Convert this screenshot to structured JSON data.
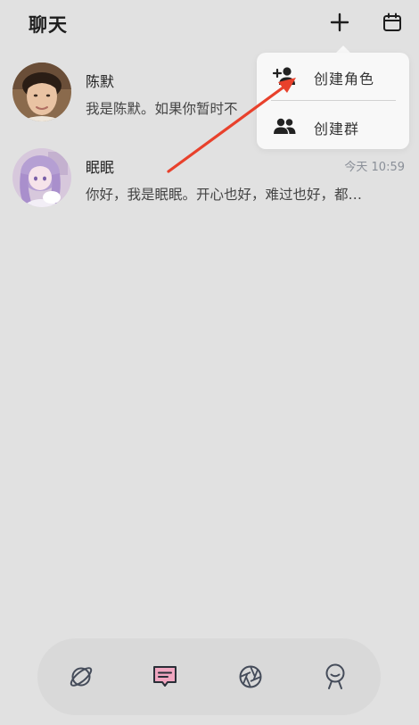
{
  "header": {
    "title": "聊天"
  },
  "chats": [
    {
      "name": "陈默",
      "preview": "我是陈默。如果你暂时不",
      "time": ""
    },
    {
      "name": "眠眠",
      "preview": "你好，我是眠眠。开心也好，难过也好，都…",
      "time": "今天 10:59"
    }
  ],
  "menu": {
    "items": [
      {
        "label": "创建角色",
        "icon": "add-person-icon"
      },
      {
        "label": "创建群",
        "icon": "group-icon"
      }
    ]
  },
  "nav": {
    "items": [
      {
        "icon": "planet-icon",
        "active": false
      },
      {
        "icon": "chat-icon",
        "active": true
      },
      {
        "icon": "aperture-icon",
        "active": false
      },
      {
        "icon": "profile-icon",
        "active": false
      }
    ]
  },
  "colors": {
    "background": "#e1e1e1",
    "menu_bg": "#f8f8f8",
    "annotation_arrow": "#e8412c",
    "active_nav_accent": "#f0a6c0",
    "time_text": "#8a8f98"
  }
}
